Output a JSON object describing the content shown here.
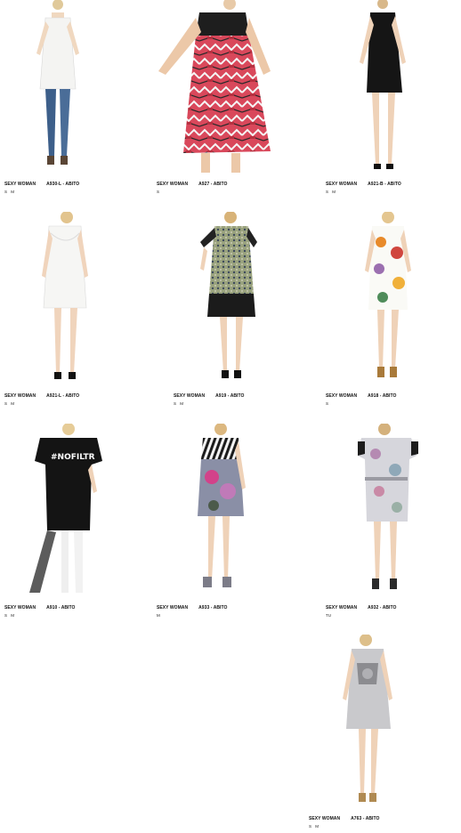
{
  "products": [
    {
      "brand": "SEXY WOMAN",
      "code": "A930-L - ABITO",
      "sizes": [
        "S",
        "M"
      ],
      "look": "white-top-jeans"
    },
    {
      "brand": "SEXY WOMAN",
      "code": "A927 - ABITO",
      "sizes": [
        "S"
      ],
      "look": "aztec-red-dress"
    },
    {
      "brand": "SEXY WOMAN",
      "code": "A921-B - ABITO",
      "sizes": [
        "S",
        "M"
      ],
      "look": "black-dress"
    },
    {
      "brand": "SEXY WOMAN",
      "code": "A921-L - ABITO",
      "sizes": [
        "S",
        "M"
      ],
      "look": "white-drape-dress"
    },
    {
      "brand": "SEXY WOMAN",
      "code": "A919 - ABITO",
      "sizes": [
        "S",
        "M"
      ],
      "look": "print-lace-dress"
    },
    {
      "brand": "SEXY WOMAN",
      "code": "A918 - ABITO",
      "sizes": [
        "S"
      ],
      "look": "floral-dress"
    },
    {
      "brand": "SEXY WOMAN",
      "code": "A910 - ABITO",
      "sizes": [
        "S",
        "M"
      ],
      "look": "black-tee-dress"
    },
    {
      "brand": "SEXY WOMAN",
      "code": "A933 - ABITO",
      "sizes": [
        "M"
      ],
      "look": "stripe-floral-dress"
    },
    {
      "brand": "SEXY WOMAN",
      "code": "A932 - ABITO",
      "sizes": [
        "TU"
      ],
      "look": "grey-print-dress"
    },
    {
      "brand": "SEXY WOMAN",
      "code": "A763 - ABITO",
      "sizes": [
        "S",
        "M"
      ],
      "look": "grey-tank-dress"
    }
  ]
}
